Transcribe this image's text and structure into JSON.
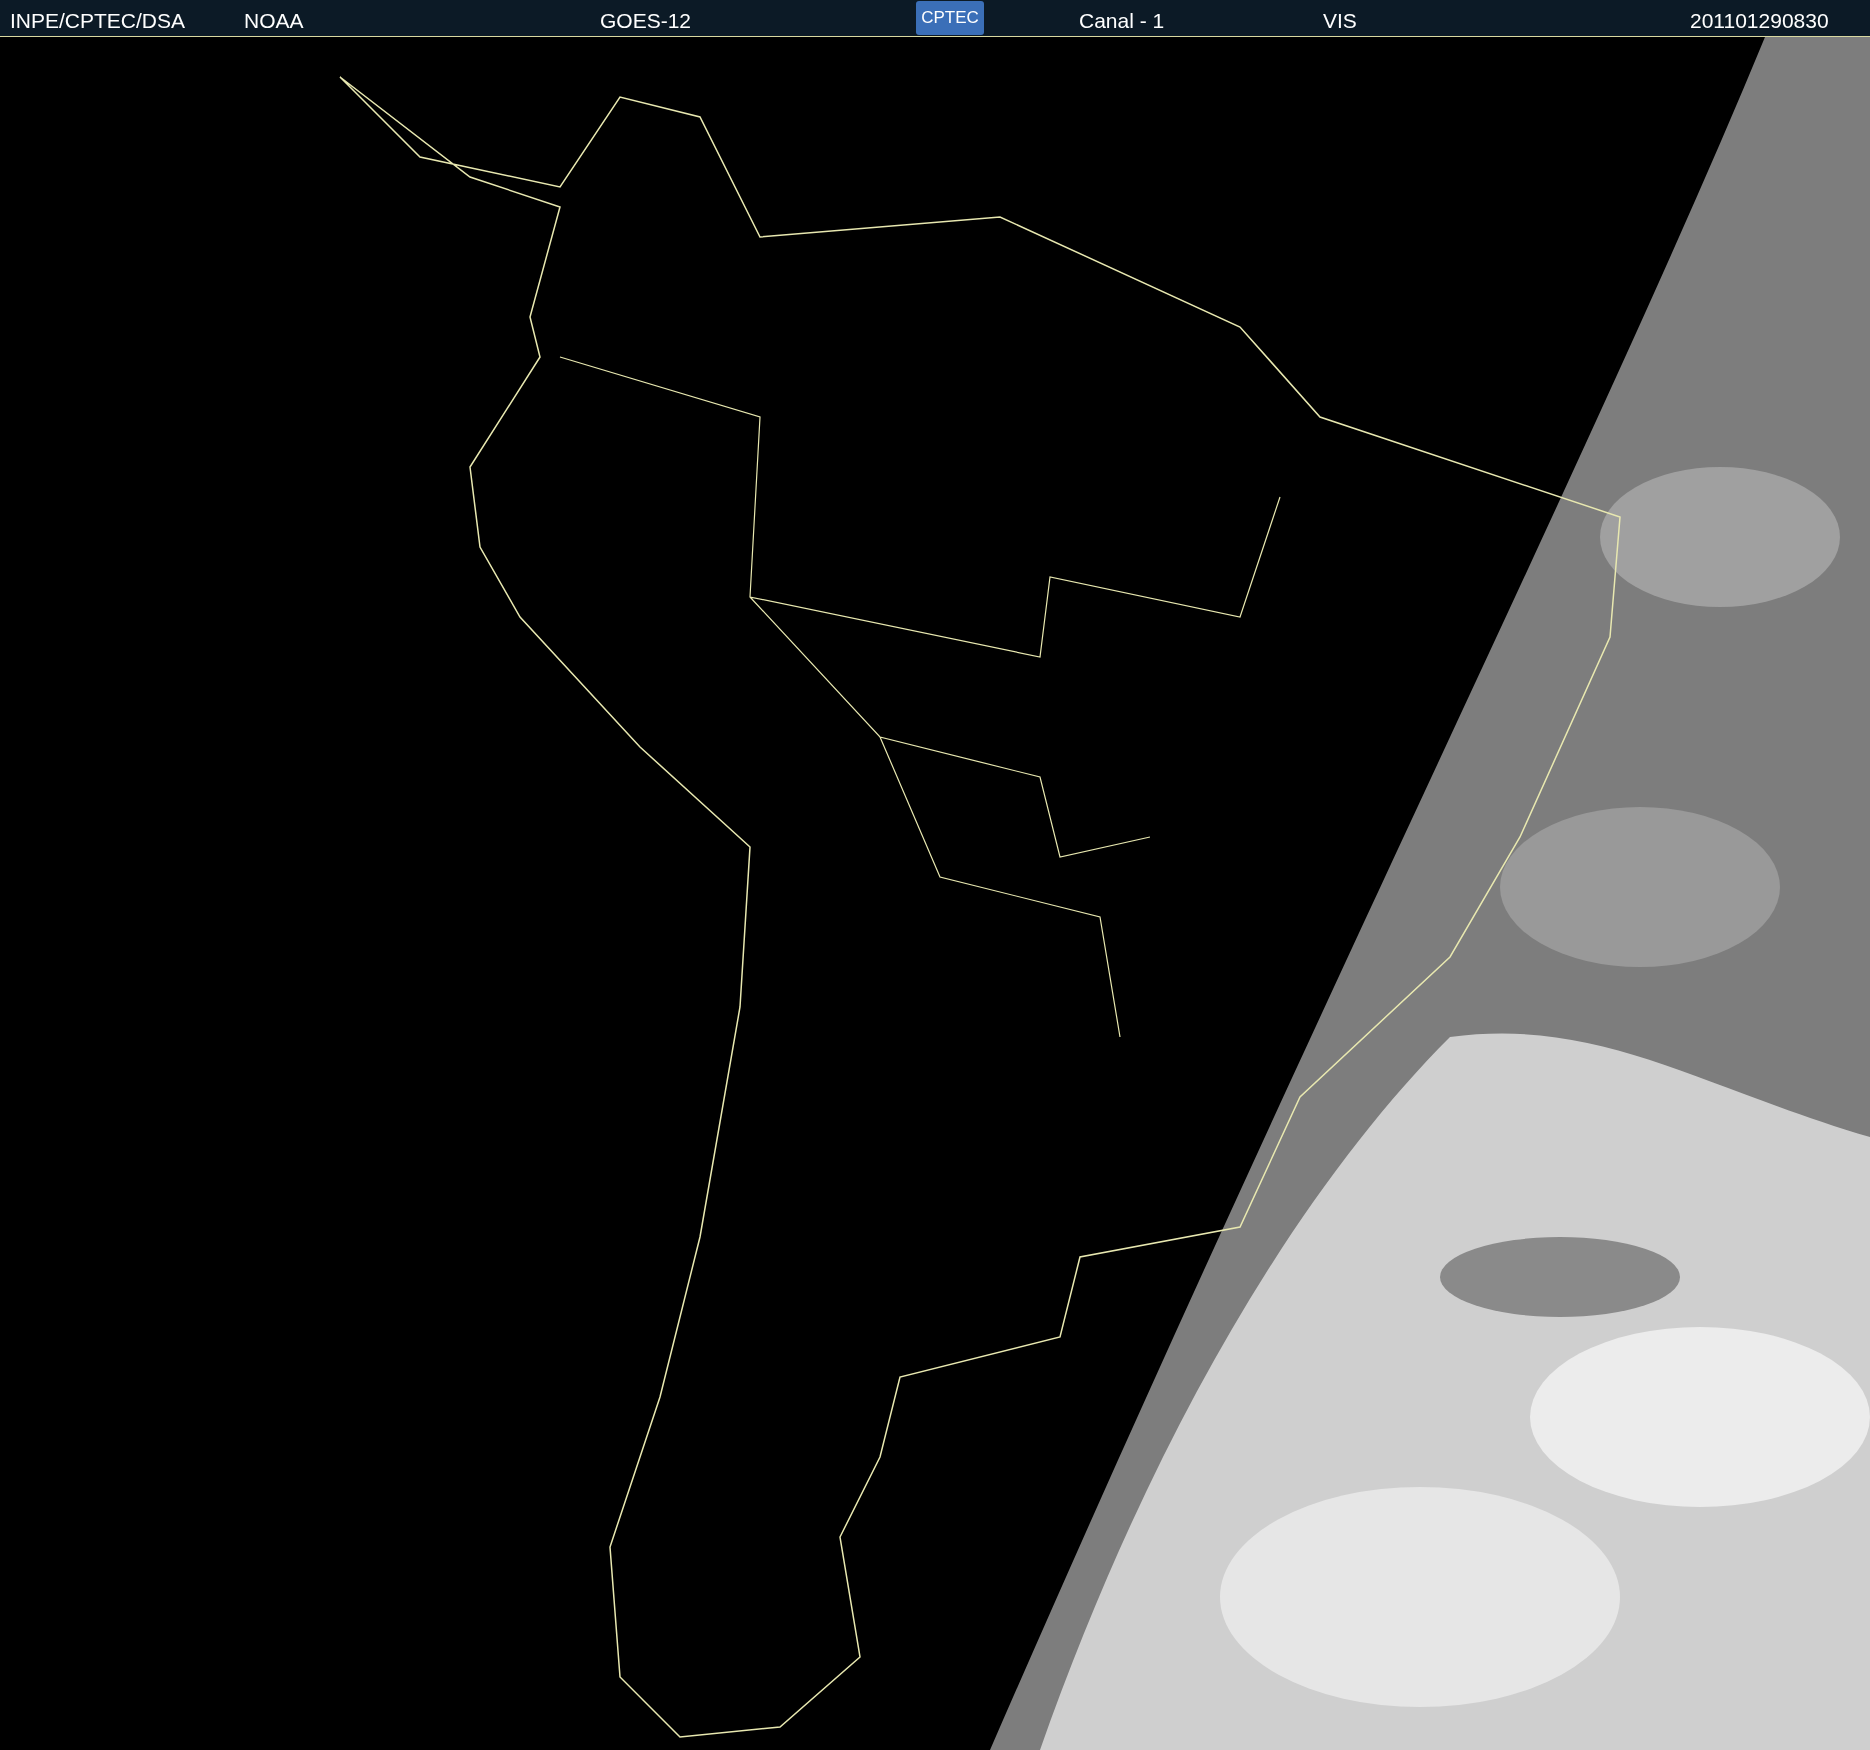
{
  "header": {
    "items": [
      {
        "kind": "text",
        "label": "INPE/CPTEC/DSA"
      },
      {
        "kind": "text",
        "label": "NOAA"
      },
      {
        "kind": "text",
        "label": "GOES-12"
      },
      {
        "kind": "logo",
        "label": "CPTEC"
      },
      {
        "kind": "text",
        "label": "Canal - 1"
      },
      {
        "kind": "text",
        "label": "VIS"
      },
      {
        "kind": "text",
        "label": "201101290830"
      }
    ]
  }
}
